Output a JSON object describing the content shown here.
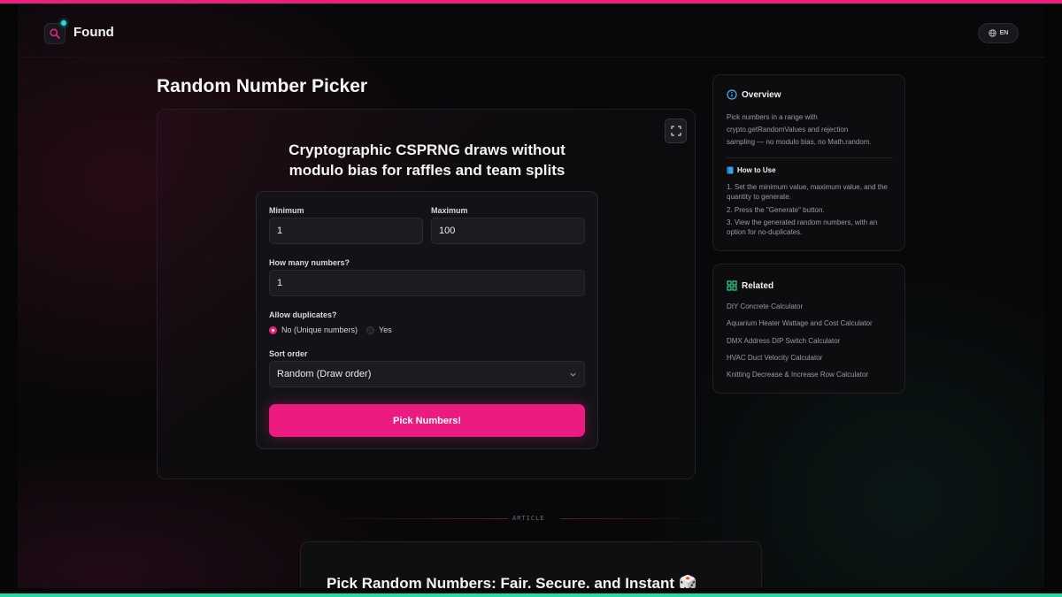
{
  "colors": {
    "accent": "#e8217d",
    "teal": "#2ad6a4",
    "cyan_dot": "#27d9e3",
    "related_icon": "#2bd68b",
    "info_icon": "#39b8f0"
  },
  "header": {
    "brand": "Found",
    "language": "EN",
    "logo_icon": "search-icon",
    "language_icon": "globe-icon"
  },
  "page": {
    "title": "Random Number Picker"
  },
  "tool": {
    "heading_line1": "Cryptographic CSPRNG draws without",
    "heading_line2": "modulo bias for raffles and team splits",
    "fullscreen_icon": "expand-icon",
    "minimum_label": "Minimum",
    "minimum_value": "1",
    "maximum_label": "Maximum",
    "maximum_value": "100",
    "count_label": "How many numbers?",
    "count_value": "1",
    "duplicates_label": "Allow duplicates?",
    "duplicates_options": [
      "No (Unique numbers)",
      "Yes"
    ],
    "duplicates_selected": "No (Unique numbers)",
    "sort_label": "Sort order",
    "sort_value": "Random (Draw order)",
    "submit_label": "Pick Numbers!"
  },
  "overview": {
    "title": "Overview",
    "text_line1": "Pick numbers in a range with",
    "text_line2": "crypto.getRandomValues and rejection",
    "text_line3": "sampling — no modulo bias, no Math.random.",
    "howto_title": "How to Use",
    "steps": [
      "1. Set the minimum value, maximum value, and the quantity to generate.",
      "2. Press the \"Generate\" button.",
      "3. View the generated random numbers, with an option for no-duplicates."
    ]
  },
  "related": {
    "title": "Related",
    "links": [
      "DIY Concrete Calculator",
      "Aquarium Heater Wattage and Cost Calculator",
      "DMX Address DIP Switch Calculator",
      "HVAC Duct Velocity Calculator",
      "Knitting Decrease & Increase Row Calculator"
    ]
  },
  "article": {
    "section_label": "ARTICLE",
    "title": "Pick Random Numbers: Fair, Secure, and Instant 🎲"
  }
}
